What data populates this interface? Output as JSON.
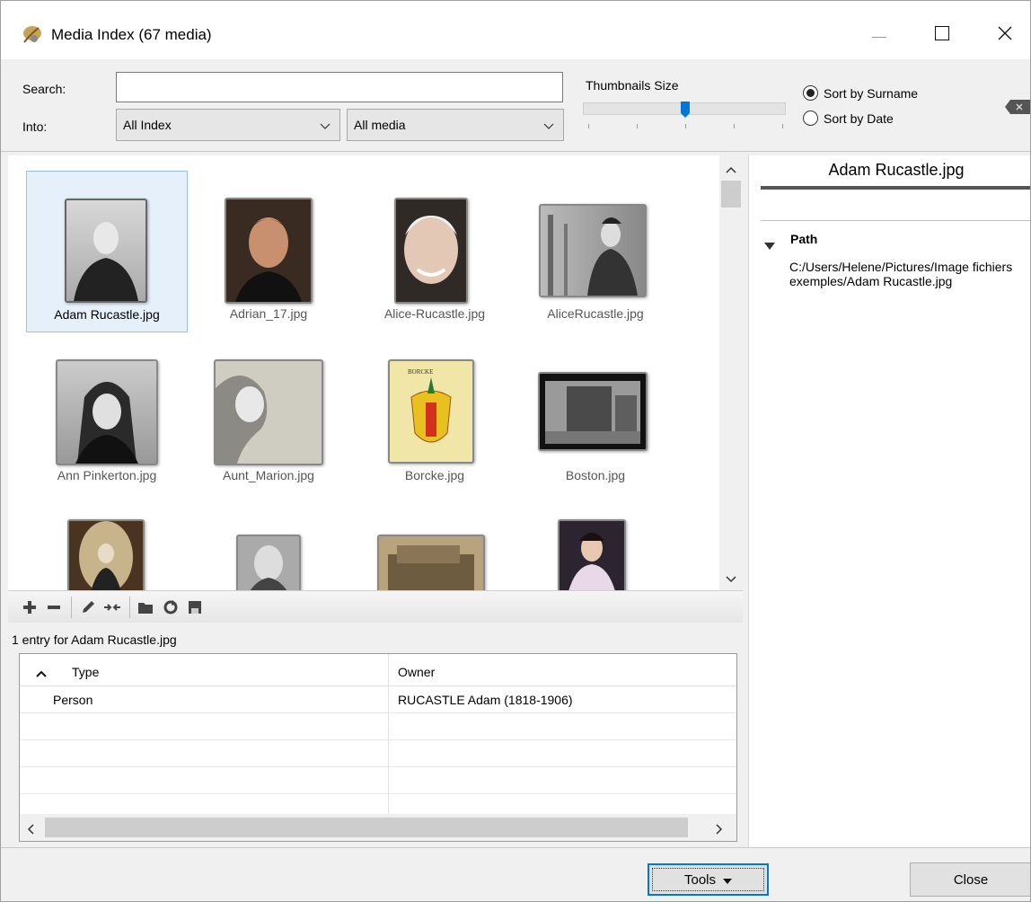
{
  "window": {
    "title": "Media Index (67 media)",
    "icons": {
      "app": "feather-app-icon",
      "minimize": "minimize-icon",
      "maximize": "maximize-icon",
      "close": "close-icon"
    }
  },
  "search": {
    "label": "Search:",
    "value": "",
    "into_label": "Into:",
    "scope_selected": "All Index",
    "media_selected": "All media",
    "thumbnail_size_label": "Thumbnails Size",
    "thumbnail_size_level": 0.5,
    "sort_options": [
      {
        "label": "Sort by Surname",
        "selected": true
      },
      {
        "label": "Sort by Date",
        "selected": false
      }
    ]
  },
  "gallery": {
    "items": [
      {
        "label": "Adam Rucastle.jpg",
        "selected": true
      },
      {
        "label": "Adrian_17.jpg",
        "selected": false
      },
      {
        "label": "Alice-Rucastle.jpg",
        "selected": false
      },
      {
        "label": "AliceRucastle.jpg",
        "selected": false
      },
      {
        "label": "Ann Pinkerton.jpg",
        "selected": false
      },
      {
        "label": "Aunt_Marion.jpg",
        "selected": false
      },
      {
        "label": "Borcke.jpg",
        "selected": false
      },
      {
        "label": "Boston.jpg",
        "selected": false
      }
    ]
  },
  "toolbar": {
    "icons": [
      "add-icon",
      "remove-icon",
      "edit-icon",
      "merge-icon",
      "open-folder-icon",
      "refresh-icon",
      "save-icon"
    ]
  },
  "entries": {
    "summary": "1 entry for Adam Rucastle.jpg",
    "columns": [
      "Type",
      "Owner"
    ],
    "rows": [
      {
        "type": "Person",
        "owner": "RUCASTLE Adam (1818-1906)"
      }
    ]
  },
  "details": {
    "title": "Adam Rucastle.jpg",
    "path_heading": "Path",
    "path_value": "C:/Users/Helene/Pictures/Image fichiers exemples/Adam Rucastle.jpg"
  },
  "buttons": {
    "tools": "Tools",
    "close": "Close"
  },
  "colors": {
    "accent": "#0078d7",
    "selection_bg": "#e5f0fb",
    "selection_border": "#99c1ea"
  }
}
